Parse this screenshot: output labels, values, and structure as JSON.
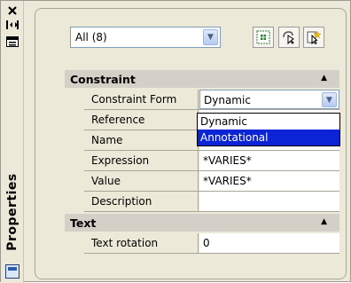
{
  "window": {
    "title": "Properties"
  },
  "selection": {
    "value": "All (8)"
  },
  "categories": [
    {
      "name": "Constraint",
      "rows": [
        {
          "label": "Constraint Form",
          "value": "Dynamic"
        },
        {
          "label": "Reference",
          "value": ""
        },
        {
          "label": "Name",
          "value": ""
        },
        {
          "label": "Expression",
          "value": "*VARIES*"
        },
        {
          "label": "Value",
          "value": "*VARIES*"
        },
        {
          "label": "Description",
          "value": ""
        }
      ]
    },
    {
      "name": "Text",
      "rows": [
        {
          "label": "Text rotation",
          "value": "0"
        }
      ]
    }
  ],
  "dropdown": {
    "options": [
      "Dynamic",
      "Annotational"
    ],
    "highlighted": "Annotational"
  },
  "icons": {
    "close": "close-icon",
    "autohide": "auto-hide-icon",
    "properties_menu": "properties-menu-icon",
    "toggle_pickadd": "toggle-pickadd-icon",
    "select_objects": "select-objects-icon",
    "quick_select": "quick-select-icon",
    "palette": "palette-icon"
  },
  "colors": {
    "highlight": "#0a24d6",
    "panel_bg": "#ece9d8"
  }
}
